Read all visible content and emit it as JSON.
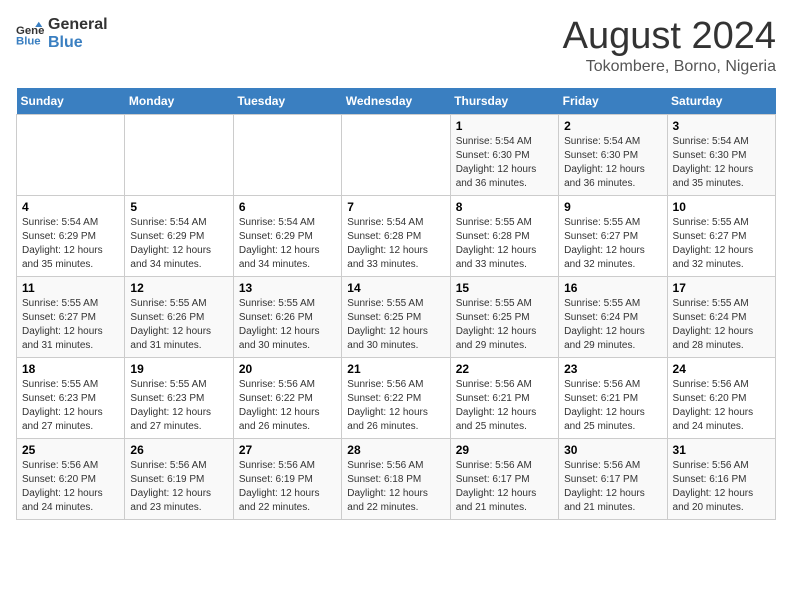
{
  "header": {
    "logo_line1": "General",
    "logo_line2": "Blue",
    "month_year": "August 2024",
    "location": "Tokombere, Borno, Nigeria"
  },
  "weekdays": [
    "Sunday",
    "Monday",
    "Tuesday",
    "Wednesday",
    "Thursday",
    "Friday",
    "Saturday"
  ],
  "weeks": [
    [
      {
        "day": "",
        "info": ""
      },
      {
        "day": "",
        "info": ""
      },
      {
        "day": "",
        "info": ""
      },
      {
        "day": "",
        "info": ""
      },
      {
        "day": "1",
        "info": "Sunrise: 5:54 AM\nSunset: 6:30 PM\nDaylight: 12 hours\nand 36 minutes."
      },
      {
        "day": "2",
        "info": "Sunrise: 5:54 AM\nSunset: 6:30 PM\nDaylight: 12 hours\nand 36 minutes."
      },
      {
        "day": "3",
        "info": "Sunrise: 5:54 AM\nSunset: 6:30 PM\nDaylight: 12 hours\nand 35 minutes."
      }
    ],
    [
      {
        "day": "4",
        "info": "Sunrise: 5:54 AM\nSunset: 6:29 PM\nDaylight: 12 hours\nand 35 minutes."
      },
      {
        "day": "5",
        "info": "Sunrise: 5:54 AM\nSunset: 6:29 PM\nDaylight: 12 hours\nand 34 minutes."
      },
      {
        "day": "6",
        "info": "Sunrise: 5:54 AM\nSunset: 6:29 PM\nDaylight: 12 hours\nand 34 minutes."
      },
      {
        "day": "7",
        "info": "Sunrise: 5:54 AM\nSunset: 6:28 PM\nDaylight: 12 hours\nand 33 minutes."
      },
      {
        "day": "8",
        "info": "Sunrise: 5:55 AM\nSunset: 6:28 PM\nDaylight: 12 hours\nand 33 minutes."
      },
      {
        "day": "9",
        "info": "Sunrise: 5:55 AM\nSunset: 6:27 PM\nDaylight: 12 hours\nand 32 minutes."
      },
      {
        "day": "10",
        "info": "Sunrise: 5:55 AM\nSunset: 6:27 PM\nDaylight: 12 hours\nand 32 minutes."
      }
    ],
    [
      {
        "day": "11",
        "info": "Sunrise: 5:55 AM\nSunset: 6:27 PM\nDaylight: 12 hours\nand 31 minutes."
      },
      {
        "day": "12",
        "info": "Sunrise: 5:55 AM\nSunset: 6:26 PM\nDaylight: 12 hours\nand 31 minutes."
      },
      {
        "day": "13",
        "info": "Sunrise: 5:55 AM\nSunset: 6:26 PM\nDaylight: 12 hours\nand 30 minutes."
      },
      {
        "day": "14",
        "info": "Sunrise: 5:55 AM\nSunset: 6:25 PM\nDaylight: 12 hours\nand 30 minutes."
      },
      {
        "day": "15",
        "info": "Sunrise: 5:55 AM\nSunset: 6:25 PM\nDaylight: 12 hours\nand 29 minutes."
      },
      {
        "day": "16",
        "info": "Sunrise: 5:55 AM\nSunset: 6:24 PM\nDaylight: 12 hours\nand 29 minutes."
      },
      {
        "day": "17",
        "info": "Sunrise: 5:55 AM\nSunset: 6:24 PM\nDaylight: 12 hours\nand 28 minutes."
      }
    ],
    [
      {
        "day": "18",
        "info": "Sunrise: 5:55 AM\nSunset: 6:23 PM\nDaylight: 12 hours\nand 27 minutes."
      },
      {
        "day": "19",
        "info": "Sunrise: 5:55 AM\nSunset: 6:23 PM\nDaylight: 12 hours\nand 27 minutes."
      },
      {
        "day": "20",
        "info": "Sunrise: 5:56 AM\nSunset: 6:22 PM\nDaylight: 12 hours\nand 26 minutes."
      },
      {
        "day": "21",
        "info": "Sunrise: 5:56 AM\nSunset: 6:22 PM\nDaylight: 12 hours\nand 26 minutes."
      },
      {
        "day": "22",
        "info": "Sunrise: 5:56 AM\nSunset: 6:21 PM\nDaylight: 12 hours\nand 25 minutes."
      },
      {
        "day": "23",
        "info": "Sunrise: 5:56 AM\nSunset: 6:21 PM\nDaylight: 12 hours\nand 25 minutes."
      },
      {
        "day": "24",
        "info": "Sunrise: 5:56 AM\nSunset: 6:20 PM\nDaylight: 12 hours\nand 24 minutes."
      }
    ],
    [
      {
        "day": "25",
        "info": "Sunrise: 5:56 AM\nSunset: 6:20 PM\nDaylight: 12 hours\nand 24 minutes."
      },
      {
        "day": "26",
        "info": "Sunrise: 5:56 AM\nSunset: 6:19 PM\nDaylight: 12 hours\nand 23 minutes."
      },
      {
        "day": "27",
        "info": "Sunrise: 5:56 AM\nSunset: 6:19 PM\nDaylight: 12 hours\nand 22 minutes."
      },
      {
        "day": "28",
        "info": "Sunrise: 5:56 AM\nSunset: 6:18 PM\nDaylight: 12 hours\nand 22 minutes."
      },
      {
        "day": "29",
        "info": "Sunrise: 5:56 AM\nSunset: 6:17 PM\nDaylight: 12 hours\nand 21 minutes."
      },
      {
        "day": "30",
        "info": "Sunrise: 5:56 AM\nSunset: 6:17 PM\nDaylight: 12 hours\nand 21 minutes."
      },
      {
        "day": "31",
        "info": "Sunrise: 5:56 AM\nSunset: 6:16 PM\nDaylight: 12 hours\nand 20 minutes."
      }
    ]
  ]
}
